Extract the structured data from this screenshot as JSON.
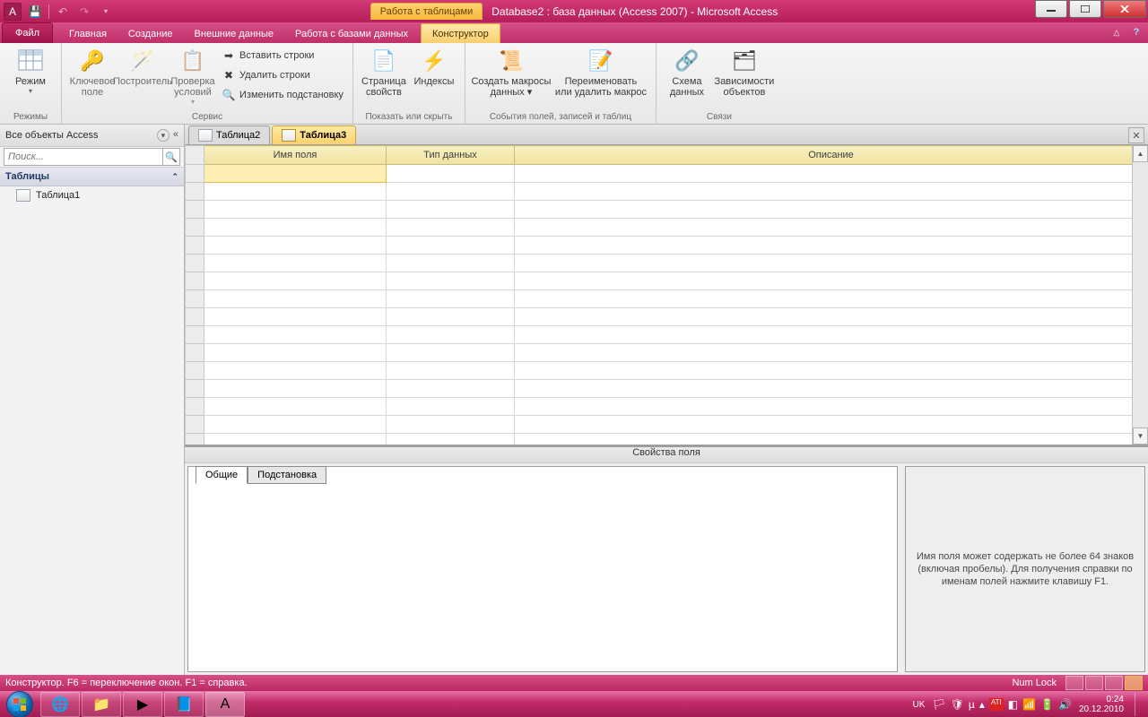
{
  "titlebar": {
    "context_label": "Работа с таблицами",
    "app_title": "Database2 : база данных (Access 2007)  -  Microsoft Access"
  },
  "tabs": {
    "file": "Файл",
    "items": [
      "Главная",
      "Создание",
      "Внешние данные",
      "Работа с базами данных"
    ],
    "context": "Конструктор"
  },
  "ribbon": {
    "g1": {
      "btn_mode": "Режим",
      "label": "Режимы"
    },
    "g2": {
      "btn_key": "Ключевое\nполе",
      "btn_builder": "Построитель",
      "btn_valid": "Проверка\nусловий",
      "s_insert": "Вставить строки",
      "s_delete": "Удалить строки",
      "s_lookup": "Изменить подстановку",
      "label": "Сервис"
    },
    "g3": {
      "btn_prop": "Страница\nсвойств",
      "btn_idx": "Индексы",
      "label": "Показать или скрыть"
    },
    "g4": {
      "btn_macro": "Создать макросы\nданных ▾",
      "btn_rename": "Переименовать\nили удалить макрос",
      "label": "События полей, записей и таблиц"
    },
    "g5": {
      "btn_rel": "Схема\nданных",
      "btn_dep": "Зависимости\nобъектов",
      "label": "Связи"
    }
  },
  "nav": {
    "header": "Все объекты Access",
    "search_placeholder": "Поиск...",
    "group": "Таблицы",
    "item": "Таблица1"
  },
  "doc": {
    "tab1": "Таблица2",
    "tab2": "Таблица3",
    "col_field": "Имя поля",
    "col_type": "Тип данных",
    "col_desc": "Описание"
  },
  "props": {
    "header": "Свойства поля",
    "tab_general": "Общие",
    "tab_lookup": "Подстановка",
    "help": "Имя поля может содержать не более 64 знаков (включая пробелы). Для получения справки по именам полей нажмите клавишу F1."
  },
  "status": {
    "left": "Конструктор.   F6 = переключение окон.   F1 = справка.",
    "numlock": "Num Lock"
  },
  "tray": {
    "lang": "UK",
    "time": "0:24",
    "date": "20.12.2010"
  }
}
